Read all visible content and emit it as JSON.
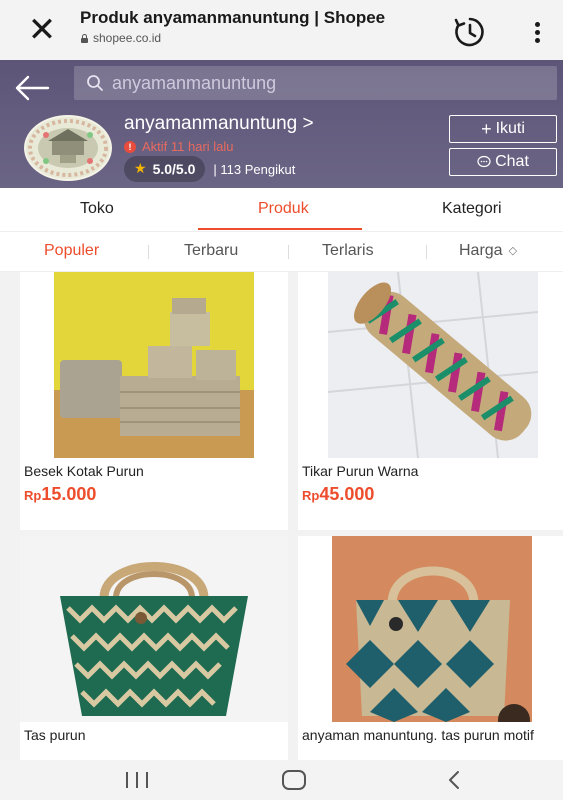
{
  "browser": {
    "title": "Produk anyamanmanuntung | Shopee",
    "domain": "shopee.co.id"
  },
  "search": {
    "placeholder": "anyamanmanuntung"
  },
  "shop": {
    "name": "anyamanmanuntung >",
    "status": "Aktif 11 hari lalu",
    "rating": "5.0/5.0",
    "followers": "| 113 Pengikut",
    "follow_label": "Ikuti",
    "chat_label": "Chat"
  },
  "tabs": [
    {
      "label": "Toko"
    },
    {
      "label": "Produk"
    },
    {
      "label": "Kategori"
    }
  ],
  "sort": [
    {
      "label": "Populer"
    },
    {
      "label": "Terbaru"
    },
    {
      "label": "Terlaris"
    },
    {
      "label": "Harga"
    }
  ],
  "products": [
    {
      "name": "Besek Kotak Purun",
      "currency": "Rp",
      "price": "15.000"
    },
    {
      "name": "Tikar Purun Warna",
      "currency": "Rp",
      "price": "45.000"
    },
    {
      "name": "Tas purun",
      "currency": "",
      "price": ""
    },
    {
      "name": "anyaman manuntung. tas purun motif",
      "currency": "",
      "price": ""
    }
  ],
  "colors": {
    "accent": "#ee4d2d",
    "header_bg": "#5d5578",
    "star": "#f5b400"
  }
}
